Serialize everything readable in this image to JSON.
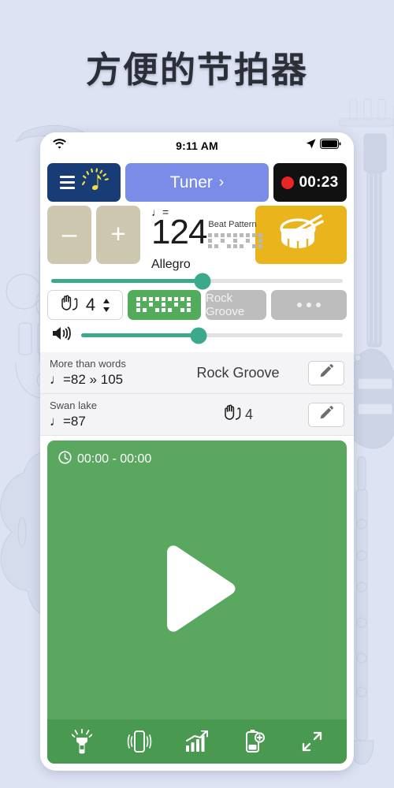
{
  "headline": "方便的节拍器",
  "statusbar": {
    "time": "9:11 AM",
    "wifi_icon": "wifi-icon",
    "location_icon": "location-arrow-icon",
    "battery_icon": "battery-icon"
  },
  "toolbar_top": {
    "menu_icon": "hamburger-menu-icon",
    "metronome_icon": "metronome-note-icon",
    "tuner_label": "Tuner",
    "tuner_chevron": "›",
    "record_time": "00:23",
    "record_dot": "record-dot-icon"
  },
  "tempo": {
    "minus_label": "–",
    "plus_label": "+",
    "note_equals": "♩=",
    "bpm": "124",
    "marking": "Allegro",
    "beat_pattern_label": "Beat Pattern",
    "drum_icon": "snare-drum-icon"
  },
  "tempo_slider": {
    "name": "tempo-slider",
    "percent": 52
  },
  "pattern_row": {
    "hand_icon": "hands-clap-icon",
    "beats": "4",
    "stepper_icon": "stepper-updown-icon",
    "pattern_button": "beat-pattern-preview",
    "groove_label": "Rock Groove",
    "more_label": "•••"
  },
  "volume_slider": {
    "name": "volume-slider",
    "speaker_icon": "speaker-volume-icon",
    "percent": 45
  },
  "songs": [
    {
      "title": "More than words",
      "tempo": "♩=82 » 105",
      "middle": "Rock Groove",
      "middle_icon": "",
      "edit_icon": "pencil-edit-icon"
    },
    {
      "title": "Swan lake",
      "tempo": "♩=87",
      "middle": "4",
      "middle_icon": "hands-clap-icon",
      "edit_icon": "pencil-edit-icon"
    }
  ],
  "player": {
    "clock_icon": "clock-icon",
    "time_range": "00:00 - 00:00",
    "play_icon": "play-triangle-icon"
  },
  "bottom_toolbar": [
    {
      "name": "flashlight-icon"
    },
    {
      "name": "vibrate-icon"
    },
    {
      "name": "stats-chart-icon"
    },
    {
      "name": "battery-plus-icon"
    },
    {
      "name": "fullscreen-expand-icon"
    }
  ],
  "colors": {
    "page_bg": "#dde3f2",
    "menu_button": "#173c76",
    "tuner_button": "#7b8ce8",
    "record_button": "#111111",
    "record_dot": "#e82626",
    "stepper_button": "#cec7b0",
    "drum_button": "#e9b41c",
    "slider_accent": "#3aa98c",
    "pattern_green": "#53ab5c",
    "player_green": "#5aa85f",
    "toolbar_green": "#4a9950",
    "gray_button": "#bdbdbd"
  }
}
